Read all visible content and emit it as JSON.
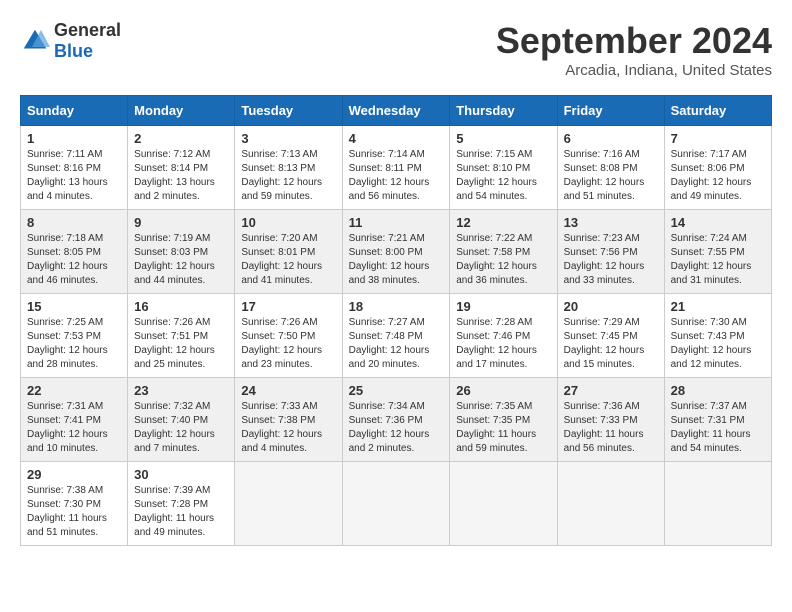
{
  "logo": {
    "general": "General",
    "blue": "Blue"
  },
  "header": {
    "month": "September 2024",
    "location": "Arcadia, Indiana, United States"
  },
  "weekdays": [
    "Sunday",
    "Monday",
    "Tuesday",
    "Wednesday",
    "Thursday",
    "Friday",
    "Saturday"
  ],
  "weeks": [
    [
      {
        "day": "1",
        "sunrise": "7:11 AM",
        "sunset": "8:16 PM",
        "daylight": "13 hours and 4 minutes."
      },
      {
        "day": "2",
        "sunrise": "7:12 AM",
        "sunset": "8:14 PM",
        "daylight": "13 hours and 2 minutes."
      },
      {
        "day": "3",
        "sunrise": "7:13 AM",
        "sunset": "8:13 PM",
        "daylight": "12 hours and 59 minutes."
      },
      {
        "day": "4",
        "sunrise": "7:14 AM",
        "sunset": "8:11 PM",
        "daylight": "12 hours and 56 minutes."
      },
      {
        "day": "5",
        "sunrise": "7:15 AM",
        "sunset": "8:10 PM",
        "daylight": "12 hours and 54 minutes."
      },
      {
        "day": "6",
        "sunrise": "7:16 AM",
        "sunset": "8:08 PM",
        "daylight": "12 hours and 51 minutes."
      },
      {
        "day": "7",
        "sunrise": "7:17 AM",
        "sunset": "8:06 PM",
        "daylight": "12 hours and 49 minutes."
      }
    ],
    [
      {
        "day": "8",
        "sunrise": "7:18 AM",
        "sunset": "8:05 PM",
        "daylight": "12 hours and 46 minutes."
      },
      {
        "day": "9",
        "sunrise": "7:19 AM",
        "sunset": "8:03 PM",
        "daylight": "12 hours and 44 minutes."
      },
      {
        "day": "10",
        "sunrise": "7:20 AM",
        "sunset": "8:01 PM",
        "daylight": "12 hours and 41 minutes."
      },
      {
        "day": "11",
        "sunrise": "7:21 AM",
        "sunset": "8:00 PM",
        "daylight": "12 hours and 38 minutes."
      },
      {
        "day": "12",
        "sunrise": "7:22 AM",
        "sunset": "7:58 PM",
        "daylight": "12 hours and 36 minutes."
      },
      {
        "day": "13",
        "sunrise": "7:23 AM",
        "sunset": "7:56 PM",
        "daylight": "12 hours and 33 minutes."
      },
      {
        "day": "14",
        "sunrise": "7:24 AM",
        "sunset": "7:55 PM",
        "daylight": "12 hours and 31 minutes."
      }
    ],
    [
      {
        "day": "15",
        "sunrise": "7:25 AM",
        "sunset": "7:53 PM",
        "daylight": "12 hours and 28 minutes."
      },
      {
        "day": "16",
        "sunrise": "7:26 AM",
        "sunset": "7:51 PM",
        "daylight": "12 hours and 25 minutes."
      },
      {
        "day": "17",
        "sunrise": "7:26 AM",
        "sunset": "7:50 PM",
        "daylight": "12 hours and 23 minutes."
      },
      {
        "day": "18",
        "sunrise": "7:27 AM",
        "sunset": "7:48 PM",
        "daylight": "12 hours and 20 minutes."
      },
      {
        "day": "19",
        "sunrise": "7:28 AM",
        "sunset": "7:46 PM",
        "daylight": "12 hours and 17 minutes."
      },
      {
        "day": "20",
        "sunrise": "7:29 AM",
        "sunset": "7:45 PM",
        "daylight": "12 hours and 15 minutes."
      },
      {
        "day": "21",
        "sunrise": "7:30 AM",
        "sunset": "7:43 PM",
        "daylight": "12 hours and 12 minutes."
      }
    ],
    [
      {
        "day": "22",
        "sunrise": "7:31 AM",
        "sunset": "7:41 PM",
        "daylight": "12 hours and 10 minutes."
      },
      {
        "day": "23",
        "sunrise": "7:32 AM",
        "sunset": "7:40 PM",
        "daylight": "12 hours and 7 minutes."
      },
      {
        "day": "24",
        "sunrise": "7:33 AM",
        "sunset": "7:38 PM",
        "daylight": "12 hours and 4 minutes."
      },
      {
        "day": "25",
        "sunrise": "7:34 AM",
        "sunset": "7:36 PM",
        "daylight": "12 hours and 2 minutes."
      },
      {
        "day": "26",
        "sunrise": "7:35 AM",
        "sunset": "7:35 PM",
        "daylight": "11 hours and 59 minutes."
      },
      {
        "day": "27",
        "sunrise": "7:36 AM",
        "sunset": "7:33 PM",
        "daylight": "11 hours and 56 minutes."
      },
      {
        "day": "28",
        "sunrise": "7:37 AM",
        "sunset": "7:31 PM",
        "daylight": "11 hours and 54 minutes."
      }
    ],
    [
      {
        "day": "29",
        "sunrise": "7:38 AM",
        "sunset": "7:30 PM",
        "daylight": "11 hours and 51 minutes."
      },
      {
        "day": "30",
        "sunrise": "7:39 AM",
        "sunset": "7:28 PM",
        "daylight": "11 hours and 49 minutes."
      },
      null,
      null,
      null,
      null,
      null
    ]
  ],
  "labels": {
    "sunrise": "Sunrise:",
    "sunset": "Sunset:",
    "daylight": "Daylight:"
  }
}
